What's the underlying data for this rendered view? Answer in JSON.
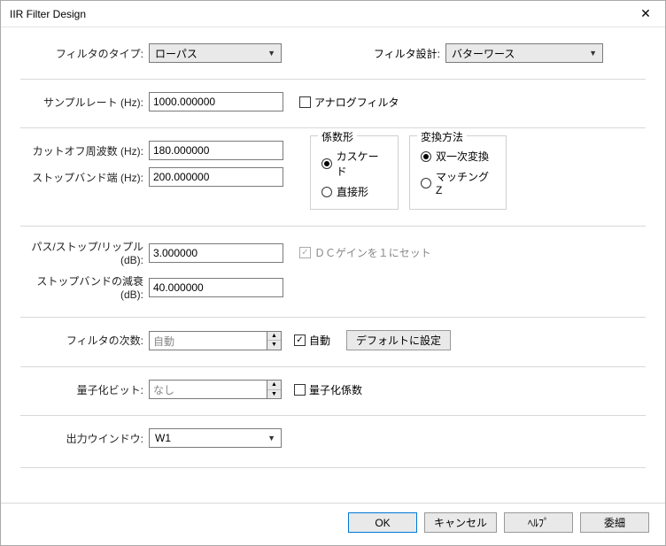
{
  "window": {
    "title": "IIR Filter Design"
  },
  "filterType": {
    "label": "フィルタのタイプ:",
    "value": "ローパス"
  },
  "filterDesign": {
    "label": "フィルタ設計:",
    "value": "バターワース"
  },
  "sampleRate": {
    "label": "サンプルレート (Hz):",
    "value": "1000.000000"
  },
  "analog": {
    "label": "アナログフィルタ"
  },
  "cutoff": {
    "label": "カットオフ周波数 (Hz):",
    "value": "180.000000"
  },
  "stopband": {
    "label": "ストップバンド端 (Hz):",
    "value": "200.000000"
  },
  "coeffForm": {
    "title": "係数形",
    "cascade": "カスケード",
    "direct": "直接形"
  },
  "transform": {
    "title": "変換方法",
    "bilinear": "双一次変換",
    "matchingZ": "マッチングZ"
  },
  "passRipple": {
    "label": "パス/ストップ/リップル (dB):",
    "value": "3.000000"
  },
  "dcGain": {
    "label": "ＤＣゲインを１にセット"
  },
  "stopAtten": {
    "label": "ストップバンドの減衰 (dB):",
    "value": "40.000000"
  },
  "order": {
    "label": "フィルタの次数:",
    "value": "自動",
    "auto": "自動",
    "defaultBtn": "デフォルトに設定"
  },
  "quant": {
    "label": "量子化ビット:",
    "value": "なし",
    "coef": "量子化係数"
  },
  "output": {
    "label": "出力ウインドウ:",
    "value": "W1"
  },
  "buttons": {
    "ok": "OK",
    "cancel": "キャンセル",
    "help": "ﾍﾙﾌﾟ",
    "detail": "委細"
  }
}
